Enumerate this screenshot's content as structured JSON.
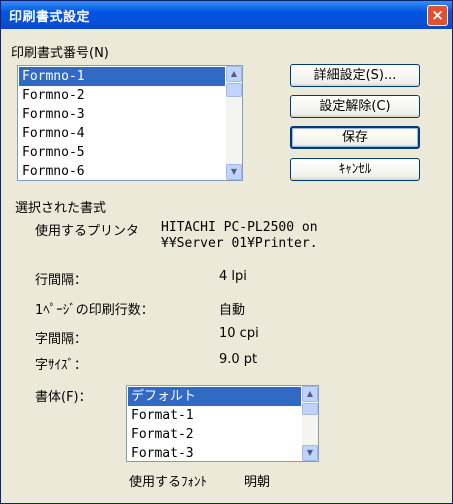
{
  "window": {
    "title": "印刷書式設定",
    "close_glyph": "×"
  },
  "format_number": {
    "label": "印刷書式番号(N)",
    "items": [
      "Formno-1",
      "Formno-2",
      "Formno-3",
      "Formno-4",
      "Formno-5",
      "Formno-6"
    ],
    "selected_index": 0
  },
  "buttons": {
    "detail": "詳細設定(S)...",
    "reset": "設定解除(C)",
    "save": "保存",
    "cancel": "ｷｬﾝｾﾙ"
  },
  "selected_format": {
    "heading": "選択された書式",
    "printer_label": "使用するプリンタ",
    "printer_line1": "HITACHI PC-PL2500 on",
    "printer_line2": "¥¥Server 01¥Printer.",
    "line_spacing_label": "行間隔：",
    "line_spacing_value": "4 lpi",
    "lines_per_page_label": "1ﾍﾟｰｼﾞの印刷行数：",
    "lines_per_page_value": "自動",
    "char_spacing_label": "字間隔：",
    "char_spacing_value": "10 cpi",
    "char_size_label": "字ｻｲｽﾞ：",
    "char_size_value": "9.0  pt"
  },
  "typeface": {
    "label": "書体(F)：",
    "items": [
      "デフォルト",
      "Format-1",
      "Format-2",
      "Format-3"
    ],
    "selected_index": 0,
    "font_label": "使用するﾌｫﾝﾄ",
    "font_value": "明朝"
  },
  "icons": {
    "scroll_up": "▲",
    "scroll_down": "▼"
  },
  "colors": {
    "title_bar": "#0054e3",
    "selection": "#316ac5",
    "close": "#e2502f",
    "dialog_bg": "#ece9d8"
  }
}
